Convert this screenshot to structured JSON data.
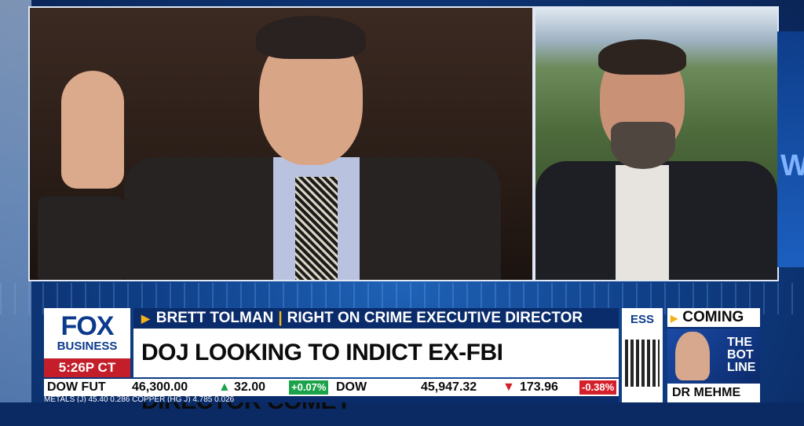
{
  "lower_third": {
    "network_logo": {
      "line1": "FOX",
      "line2": "BUSINESS"
    },
    "time": "5:26P CT",
    "guest_name": "BRETT TOLMAN",
    "guest_title": "RIGHT ON CRIME EXECUTIVE DIRECTOR",
    "headline": "DOJ LOOKING TO INDICT EX-FBI DIRECTOR COMEY"
  },
  "ticker": {
    "items": [
      {
        "label": "DOW FUT",
        "value": "46,300.00",
        "change": "32.00",
        "pct": "+0.07%",
        "direction": "up"
      },
      {
        "label": "DOW",
        "value": "45,947.32",
        "change": "173.96",
        "pct": "-0.38%",
        "direction": "down"
      }
    ],
    "second_row": "METALS   (J)   45.40   0.286   COPPER (HG J)   4.785   0.026"
  },
  "qr_panel": {
    "label": "ESS"
  },
  "coming_up": {
    "label": "COMING",
    "show_text": "THE BOT LINE",
    "host_name": "DR MEHME"
  },
  "colors": {
    "accent_red": "#c41e2a",
    "navy": "#0a2c6b",
    "gold": "#f3b21b",
    "up": "#1ba34a",
    "down": "#d4202b"
  }
}
